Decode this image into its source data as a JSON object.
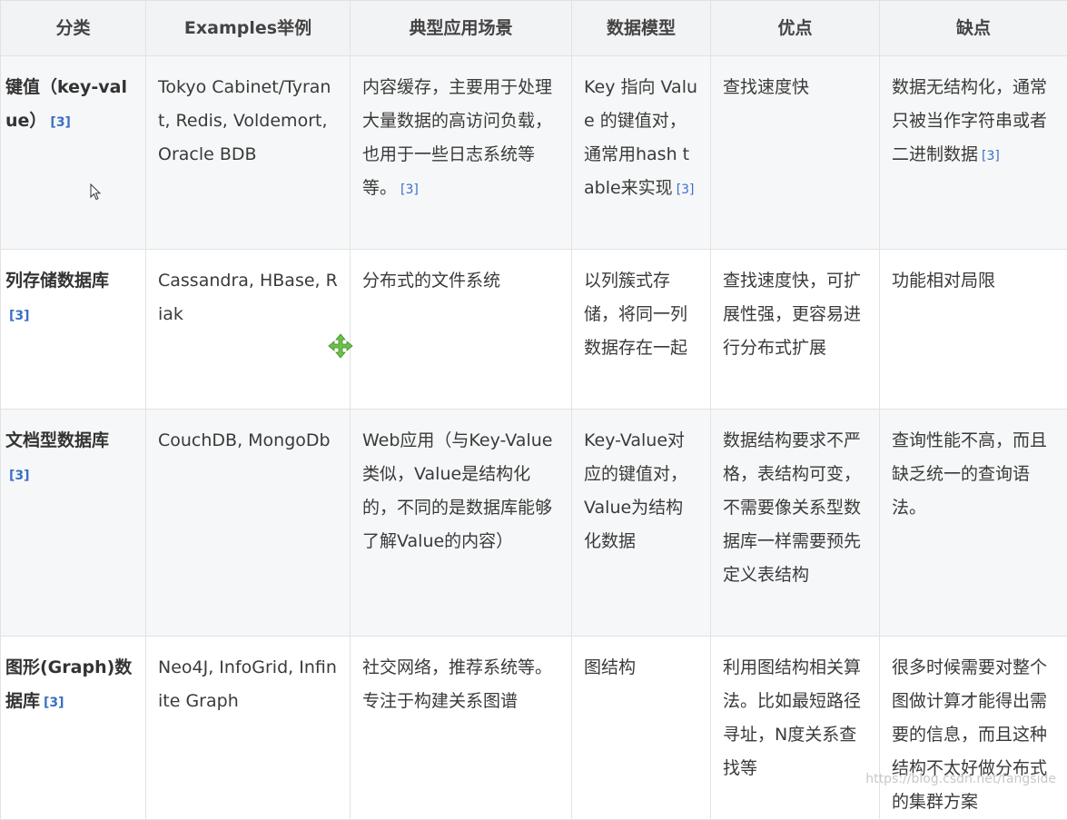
{
  "headers": [
    "分类",
    "Examples举例",
    "典型应用场景",
    "数据模型",
    "优点",
    "缺点"
  ],
  "rows": [
    {
      "category": "键值（key-value）",
      "category_ref": "[3]",
      "examples": "Tokyo Cabinet/Tyrant, Redis, Voldemort, Oracle BDB",
      "scenario": "内容缓存，主要用于处理大量数据的高访问负载，也用于一些日志系统等等。",
      "scenario_ref": "[3]",
      "model": "Key 指向 Value 的键值对，通常用hash table来实现",
      "model_ref": "[3]",
      "pros": "查找速度快",
      "cons": "数据无结构化，通常只被当作字符串或者二进制数据",
      "cons_ref": "[3]"
    },
    {
      "category": "列存储数据库",
      "category_ref": "[3]",
      "examples": "Cassandra, HBase, Riak",
      "scenario": "分布式的文件系统",
      "model": "以列簇式存储，将同一列数据存在一起",
      "pros": "查找速度快，可扩展性强，更容易进行分布式扩展",
      "cons": "功能相对局限"
    },
    {
      "category": "文档型数据库",
      "category_ref": "[3]",
      "examples": "CouchDB, MongoDb",
      "scenario": "Web应用（与Key-Value类似，Value是结构化的，不同的是数据库能够了解Value的内容）",
      "model": "Key-Value对应的键值对，Value为结构化数据",
      "pros": "数据结构要求不严格，表结构可变，不需要像关系型数据库一样需要预先定义表结构",
      "cons": "查询性能不高，而且缺乏统一的查询语法。"
    },
    {
      "category": "图形(Graph)数据库",
      "category_ref": "[3]",
      "examples": "Neo4J, InfoGrid, Infinite Graph",
      "scenario": "社交网络，推荐系统等。专注于构建关系图谱",
      "model": "图结构",
      "pros": "利用图结构相关算法。比如最短路径寻址，N度关系查找等",
      "cons": "很多时候需要对整个图做计算才能得出需要的信息，而且这种结构不太好做分布式的集群方案"
    }
  ],
  "watermark": "https://blog.csdn.net/fangside",
  "icons": {
    "pointer": "mouse-pointer-icon",
    "move": "move-cursor-icon"
  },
  "colors": {
    "link": "#3b6fc6",
    "move_icon": "#6cc04a",
    "header_bg": "#f2f3f5"
  }
}
